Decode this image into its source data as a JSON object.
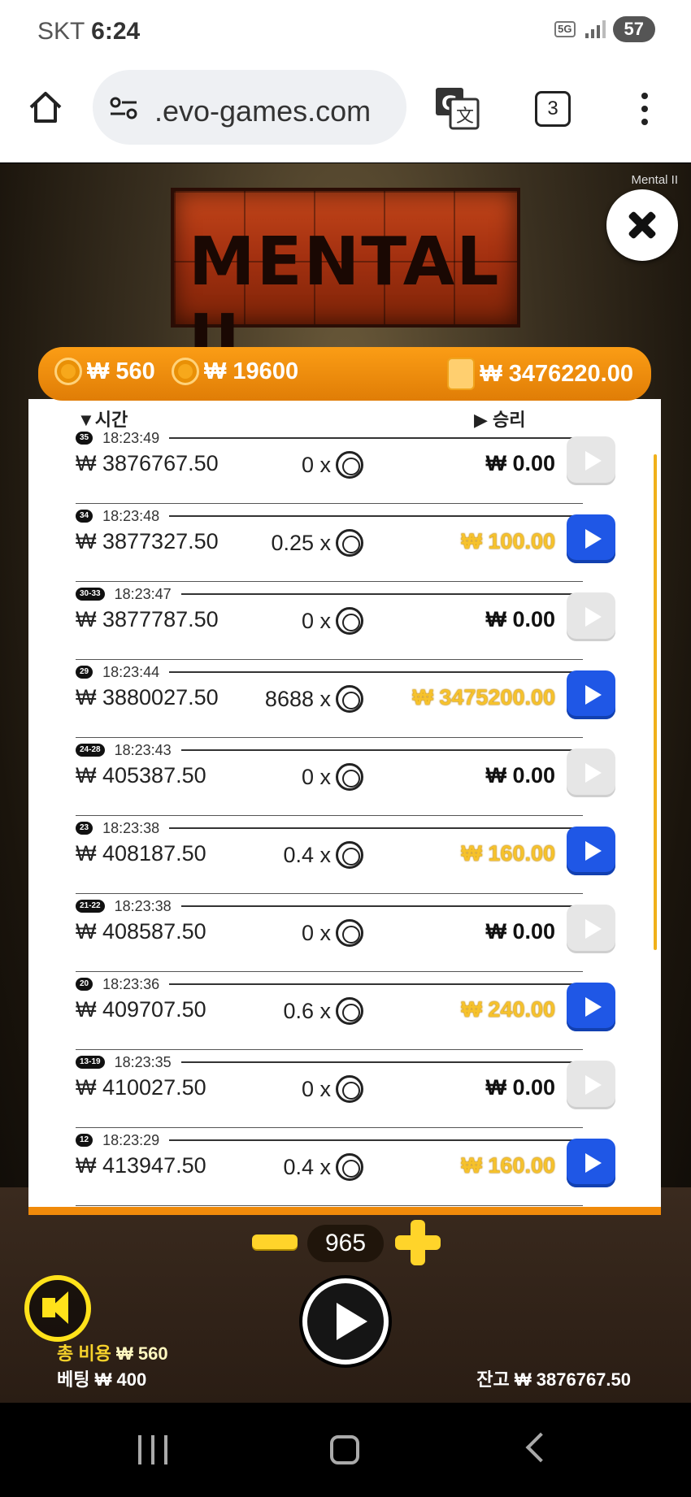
{
  "status": {
    "carrier": "SKT",
    "time": "6:24",
    "network": "5G",
    "battery": "57"
  },
  "browser": {
    "url": ".evo-games.com",
    "tab_count": "3"
  },
  "game": {
    "label": "Mental II",
    "logo_text": "MENTAL II"
  },
  "panel": {
    "coin_value": "₩ 560",
    "bonus_value": "₩ 19600",
    "wallet_value": "₩ 3476220.00",
    "col_time": "▼시간",
    "col_win": "▶ 승리"
  },
  "rows": [
    {
      "badge": "35",
      "time": "18:23:49",
      "balance": "₩ 3876767.50",
      "mult": "0 x",
      "win": "₩ 0.00",
      "highlight": false
    },
    {
      "badge": "34",
      "time": "18:23:48",
      "balance": "₩ 3877327.50",
      "mult": "0.25 x",
      "win": "₩ 100.00",
      "highlight": true
    },
    {
      "badge": "30-33",
      "time": "18:23:47",
      "balance": "₩ 3877787.50",
      "mult": "0 x",
      "win": "₩ 0.00",
      "highlight": false
    },
    {
      "badge": "29",
      "time": "18:23:44",
      "balance": "₩ 3880027.50",
      "mult": "8688 x",
      "win": "₩ 3475200.00",
      "highlight": true
    },
    {
      "badge": "24-28",
      "time": "18:23:43",
      "balance": "₩ 405387.50",
      "mult": "0 x",
      "win": "₩ 0.00",
      "highlight": false
    },
    {
      "badge": "23",
      "time": "18:23:38",
      "balance": "₩ 408187.50",
      "mult": "0.4 x",
      "win": "₩ 160.00",
      "highlight": true
    },
    {
      "badge": "21-22",
      "time": "18:23:38",
      "balance": "₩ 408587.50",
      "mult": "0 x",
      "win": "₩ 0.00",
      "highlight": false
    },
    {
      "badge": "20",
      "time": "18:23:36",
      "balance": "₩ 409707.50",
      "mult": "0.6 x",
      "win": "₩ 240.00",
      "highlight": true
    },
    {
      "badge": "13-19",
      "time": "18:23:35",
      "balance": "₩ 410027.50",
      "mult": "0 x",
      "win": "₩ 0.00",
      "highlight": false
    },
    {
      "badge": "12",
      "time": "18:23:29",
      "balance": "₩ 413947.50",
      "mult": "0.4 x",
      "win": "₩ 160.00",
      "highlight": true
    }
  ],
  "controls": {
    "bet_count": "965",
    "total_cost_label": "총 비용",
    "total_cost_value": "₩ 560",
    "bet_label": "베팅",
    "bet_value": "₩ 400",
    "balance_label": "잔고",
    "balance_value": "₩ 3876767.50"
  }
}
